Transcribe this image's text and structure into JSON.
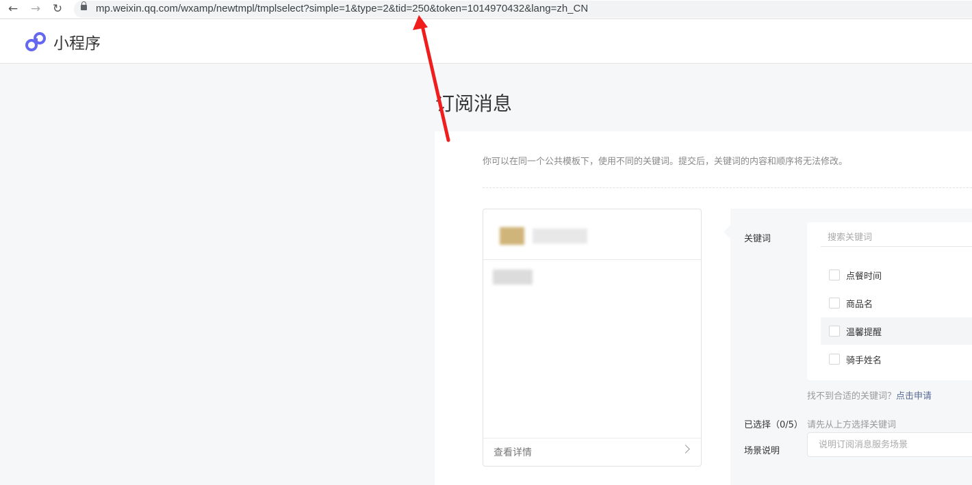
{
  "browser": {
    "back_icon": "arrow-left-icon",
    "forward_icon": "arrow-right-icon",
    "reload_icon": "reload-icon",
    "url": "mp.weixin.qq.com/wxamp/newtmpl/tmplselect?simple=1&type=2&tid=250&token=1014970432&lang=zh_CN"
  },
  "header": {
    "brand": "小程序",
    "logo_color": "#6467f0"
  },
  "page": {
    "title": "订阅消息",
    "hint": "你可以在同一个公共模板下，使用不同的关键词。提交后，关键词的内容和顺序将无法修改。"
  },
  "card": {
    "detail_label": "查看详情"
  },
  "form": {
    "keyword_label": "关键词",
    "search_placeholder": "搜索关键词",
    "keywords": [
      {
        "label": "点餐时间",
        "checked": false
      },
      {
        "label": "商品名",
        "checked": false
      },
      {
        "label": "温馨提醒",
        "checked": false
      },
      {
        "label": "骑手姓名",
        "checked": false
      }
    ],
    "not_found_text": "找不到合适的关键词？",
    "apply_link": "点击申请",
    "selected_label": "已选择（0/5）",
    "selected_hint": "请先从上方选择关键词",
    "scene_label": "场景说明",
    "scene_placeholder": "说明订阅消息服务场景"
  },
  "colors": {
    "link": "#576b95",
    "annotation_arrow": "#f01d1d"
  }
}
